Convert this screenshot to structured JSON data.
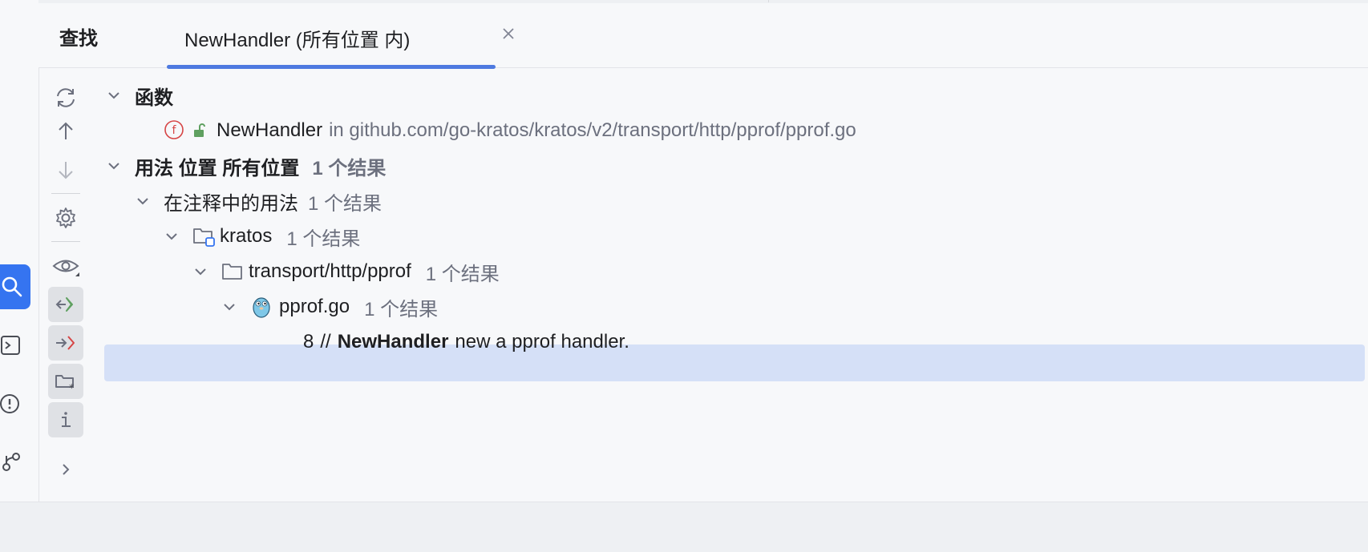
{
  "tabs": {
    "find_label": "查找",
    "active_label": "NewHandler (所有位置 内)"
  },
  "tree": {
    "functions_header": "函数",
    "function_item": {
      "name": "NewHandler",
      "in_path": "in github.com/go-kratos/kratos/v2/transport/http/pprof/pprof.go"
    },
    "usages_header": "用法 位置 所有位置",
    "usages_count": "1 个结果",
    "comment_usages": {
      "label": "在注释中的用法",
      "count": "1 个结果"
    },
    "module": {
      "label": "kratos",
      "count": "1 个结果"
    },
    "directory": {
      "label": "transport/http/pprof",
      "count": "1 个结果"
    },
    "file": {
      "label": "pprof.go",
      "count": "1 个结果"
    },
    "match": {
      "line_number": "8",
      "prefix": "//",
      "highlight": "NewHandler",
      "suffix": "new a pprof handler."
    }
  },
  "toolbar": {
    "icons": [
      "refresh-icon",
      "arrow-up-icon",
      "arrow-down-icon",
      "settings-icon",
      "eye-icon",
      "read-access-icon",
      "write-access-icon",
      "folder-scope-icon",
      "info-icon",
      "expand-chevron-icon"
    ]
  },
  "colors": {
    "accent": "#3574f0",
    "tab_underline": "#4e7ae0",
    "selection": "#d5e0f7",
    "muted_text": "#6c707e",
    "function_badge": "#d64545",
    "unlock_green": "#5fa060"
  }
}
